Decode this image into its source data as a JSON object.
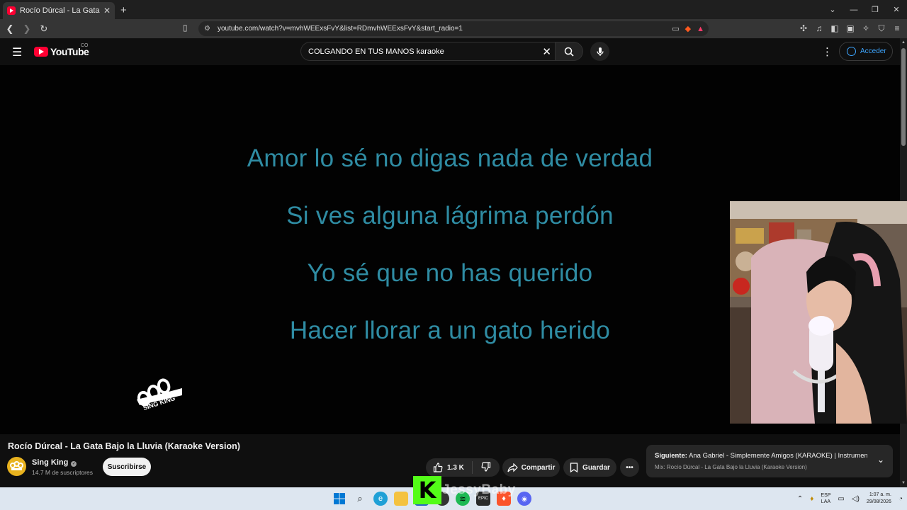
{
  "browser": {
    "tab_title": "Rocío Dúrcal - La Gata Bajo la Lluvia",
    "tab_close": "✕",
    "new_tab": "+",
    "url": "youtube.com/watch?v=mvhWEExsFvY&list=RDmvhWEExsFvY&start_radio=1"
  },
  "youtube": {
    "logo_text": "YouTube",
    "country_code": "CO",
    "search_value": "COLGANDO EN TUS MANOS karaoke",
    "signin_label": "Acceder"
  },
  "video": {
    "lyrics": [
      "Amor lo sé no digas nada de verdad",
      "Si ves alguna lágrima perdón",
      "Yo sé que no has querido",
      "Hacer llorar a un gato herido"
    ],
    "brand_text": "SING KING"
  },
  "meta": {
    "title": "Rocío Dúrcal - La Gata Bajo la Lluvia (Karaoke Version)",
    "channel": "Sing King",
    "subscribers": "14.7 M de suscriptores",
    "subscribe_label": "Suscribirse",
    "likes": "1.3 K",
    "share_label": "Compartir",
    "save_label": "Guardar"
  },
  "next_up": {
    "prefix": "Siguiente:",
    "title": "Ana Gabriel - Simplemente Amigos (KARAOKE) | Instrument...",
    "mix": "Mix: Rocío Dúrcal - La Gata Bajo la Lluvia (Karaoke Version)"
  },
  "stream": {
    "streamer_name": "JessyBaby"
  },
  "taskbar": {
    "lang_top": "ESP",
    "lang_bottom": "LAA",
    "time": "1:07 a. m.",
    "date": "29/08/2026"
  },
  "colors": {
    "lyric": "#2f8ca3",
    "youtube_red": "#ff0033",
    "link_blue": "#3ea6ff",
    "kick_green": "#53fc18"
  }
}
